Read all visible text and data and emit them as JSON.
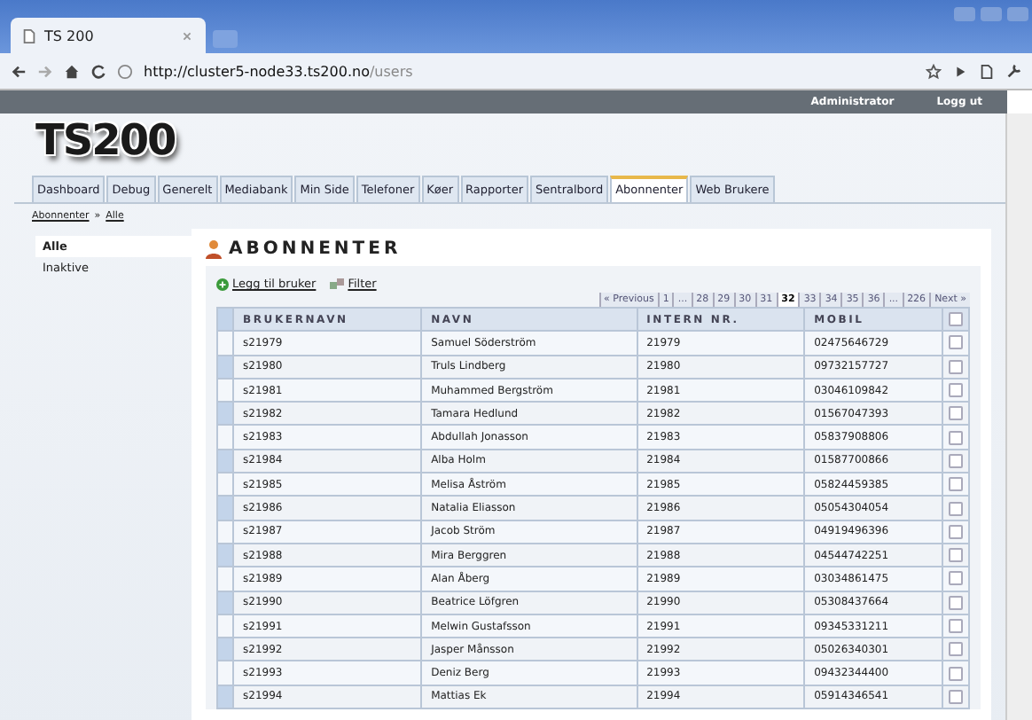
{
  "browser": {
    "tab_title": "TS 200",
    "url_host": "http://cluster5-node33.ts200.no",
    "url_path": "/users"
  },
  "header": {
    "user": "Administrator",
    "logout": "Logg ut",
    "logo": "TS200"
  },
  "tabs": [
    {
      "label": "Dashboard",
      "selected": false
    },
    {
      "label": "Debug",
      "selected": false
    },
    {
      "label": "Generelt",
      "selected": false
    },
    {
      "label": "Mediabank",
      "selected": false
    },
    {
      "label": "Min Side",
      "selected": false
    },
    {
      "label": "Telefoner",
      "selected": false
    },
    {
      "label": "Køer",
      "selected": false
    },
    {
      "label": "Rapporter",
      "selected": false
    },
    {
      "label": "Sentralbord",
      "selected": false
    },
    {
      "label": "Abonnenter",
      "selected": true
    },
    {
      "label": "Web Brukere",
      "selected": false
    }
  ],
  "breadcrumb": [
    "Abonnenter",
    "»",
    "Alle"
  ],
  "sidebar": {
    "items": [
      {
        "label": "Alle",
        "selected": true
      },
      {
        "label": "Inaktive",
        "selected": false
      }
    ]
  },
  "main": {
    "title": "ABONNENTER",
    "actions": [
      "Legg til bruker",
      "Filter"
    ],
    "pagination": [
      {
        "label": "« Previous",
        "selected": false
      },
      {
        "label": "1",
        "selected": false
      },
      {
        "label": "...",
        "selected": false
      },
      {
        "label": "28",
        "selected": false
      },
      {
        "label": "29",
        "selected": false
      },
      {
        "label": "30",
        "selected": false
      },
      {
        "label": "31",
        "selected": false
      },
      {
        "label": "32",
        "selected": true
      },
      {
        "label": "33",
        "selected": false
      },
      {
        "label": "34",
        "selected": false
      },
      {
        "label": "35",
        "selected": false
      },
      {
        "label": "36",
        "selected": false
      },
      {
        "label": "...",
        "selected": false
      },
      {
        "label": "226",
        "selected": false
      },
      {
        "label": "Next »",
        "selected": false
      }
    ],
    "table": {
      "columns": [
        "BRUKERNAVN",
        "NAVN",
        "INTERN NR.",
        "MOBIL"
      ],
      "header_checked": false,
      "rows": [
        {
          "cells": [
            "s21979",
            "Samuel Söderström",
            "21979",
            "02475646729"
          ],
          "checked": false
        },
        {
          "cells": [
            "s21980",
            "Truls Lindberg",
            "21980",
            "09732157727"
          ],
          "checked": false
        },
        {
          "cells": [
            "s21981",
            "Muhammed Bergström",
            "21981",
            "03046109842"
          ],
          "checked": false
        },
        {
          "cells": [
            "s21982",
            "Tamara Hedlund",
            "21982",
            "01567047393"
          ],
          "checked": false
        },
        {
          "cells": [
            "s21983",
            "Abdullah Jonasson",
            "21983",
            "05837908806"
          ],
          "checked": false
        },
        {
          "cells": [
            "s21984",
            "Alba Holm",
            "21984",
            "01587700866"
          ],
          "checked": false
        },
        {
          "cells": [
            "s21985",
            "Melisa Åström",
            "21985",
            "05824459385"
          ],
          "checked": false
        },
        {
          "cells": [
            "s21986",
            "Natalia Eliasson",
            "21986",
            "05054304054"
          ],
          "checked": false
        },
        {
          "cells": [
            "s21987",
            "Jacob Ström",
            "21987",
            "04919496396"
          ],
          "checked": false
        },
        {
          "cells": [
            "s21988",
            "Mira Berggren",
            "21988",
            "04544742251"
          ],
          "checked": false
        },
        {
          "cells": [
            "s21989",
            "Alan Åberg",
            "21989",
            "03034861475"
          ],
          "checked": false
        },
        {
          "cells": [
            "s21990",
            "Beatrice Löfgren",
            "21990",
            "05308437664"
          ],
          "checked": false
        },
        {
          "cells": [
            "s21991",
            "Melwin Gustafsson",
            "21991",
            "09345331211"
          ],
          "checked": false
        },
        {
          "cells": [
            "s21992",
            "Jasper Månsson",
            "21992",
            "05026340301"
          ],
          "checked": false
        },
        {
          "cells": [
            "s21993",
            "Deniz Berg",
            "21993",
            "09432344400"
          ],
          "checked": false
        },
        {
          "cells": [
            "s21994",
            "Mattias Ek",
            "21994",
            "05914346541"
          ],
          "checked": false
        }
      ]
    }
  }
}
